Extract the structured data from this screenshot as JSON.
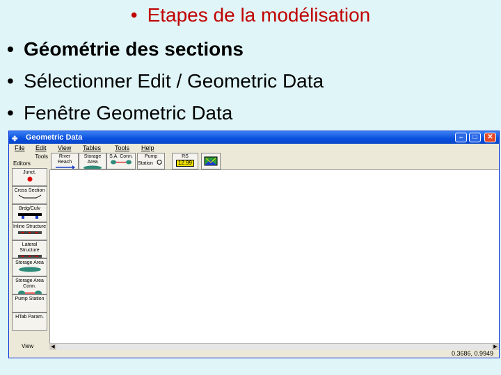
{
  "slide": {
    "title": "Etapes de la modélisation",
    "bullet_char": "•",
    "bullets": [
      "Géométrie des sections",
      "Sélectionner Edit / Geometric Data",
      "Fenêtre Geometric Data"
    ]
  },
  "window": {
    "title": "Geometric Data",
    "menu": [
      "File",
      "Edit",
      "View",
      "Tables",
      "Tools",
      "Help"
    ],
    "tools_label": "Tools",
    "editors_label": "Editors",
    "toolbar": [
      {
        "label": "River Reach",
        "icon": "river-reach-icon"
      },
      {
        "label": "Storage Area",
        "icon": "storage-area-icon"
      },
      {
        "label": "S.A. Conn.",
        "icon": "sa-connection-icon"
      },
      {
        "label": "Pump Station",
        "icon": "pump-station-icon"
      },
      {
        "label": "RS",
        "value": "12.99",
        "icon": "river-station-icon"
      },
      {
        "label": "",
        "icon": "map-image-icon"
      }
    ],
    "editors": [
      {
        "label": "Junct.",
        "icon": "junction-icon"
      },
      {
        "label": "Cross Section",
        "icon": "cross-section-icon"
      },
      {
        "label": "Brdg/Culv",
        "icon": "bridge-culvert-icon"
      },
      {
        "label": "Inline Structure",
        "icon": "inline-structure-icon"
      },
      {
        "label": "Lateral Structure",
        "icon": "lateral-structure-icon"
      },
      {
        "label": "Storage Area",
        "icon": "storage-area-icon"
      },
      {
        "label": "Storage Area Conn.",
        "icon": "storage-area-conn-icon"
      },
      {
        "label": "Pump Station",
        "icon": "pump-station-icon"
      },
      {
        "label": "HTab Param.",
        "icon": "htab-icon"
      }
    ],
    "view_label": "View",
    "status_coords": "0.3686, 0.9949",
    "colors": {
      "titlebar": "#0a4fdc",
      "junction_dot": "#e00000",
      "storage": "#2e8b7a"
    }
  }
}
